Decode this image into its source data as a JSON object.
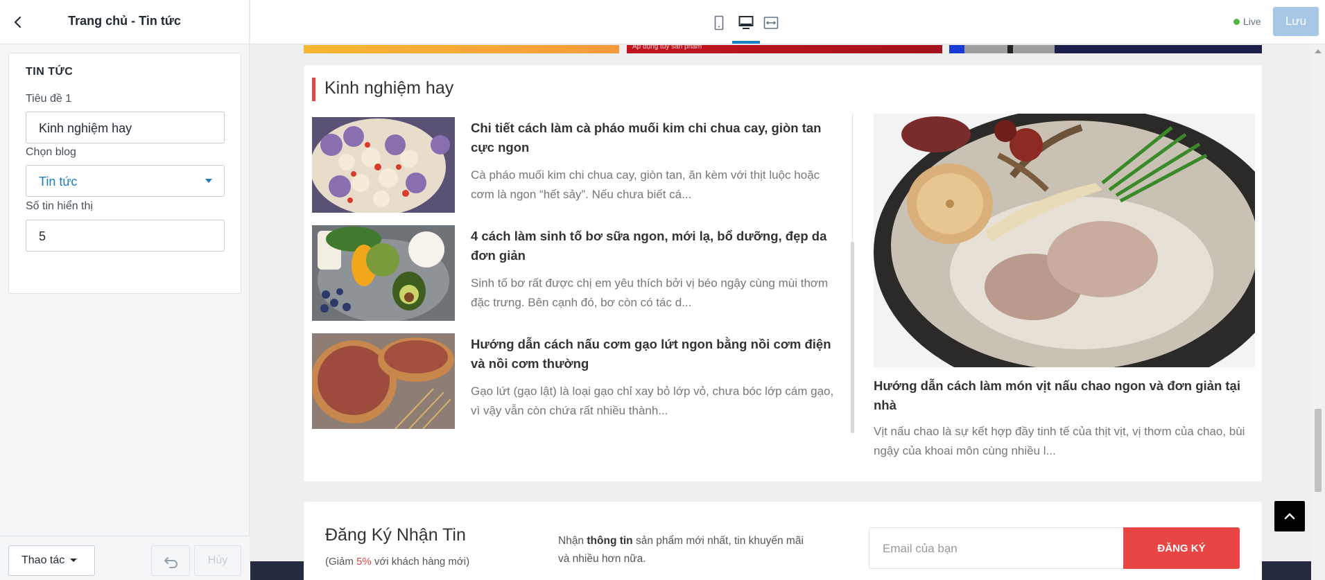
{
  "sidebar": {
    "title": "Trang chủ - Tin tức",
    "card_title": "TIN TỨC",
    "fields": {
      "title_label": "Tiêu đề 1",
      "title_value": "Kinh nghiệm hay",
      "blog_label": "Chọn blog",
      "blog_value": "Tin tức",
      "count_label": "Số tin hiển thị",
      "count_value": "5"
    },
    "footer": {
      "actions_label": "Thao tác",
      "cancel_label": "Hủy"
    }
  },
  "topbar": {
    "live_label": "Live",
    "save_label": "Lưu",
    "live_color": "#50b83c",
    "accent_color": "#1a7ec2",
    "devices": [
      "mobile-icon",
      "desktop-icon",
      "fullwidth-icon"
    ],
    "active_device": "desktop-icon"
  },
  "preview": {
    "banner_caption": "Áp dụng tùy sản phẩm",
    "section_title": "Kinh nghiệm hay",
    "articles": [
      {
        "title": "Chi tiết cách làm cà pháo muối kim chi chua cay, giòn tan cực ngon",
        "excerpt": "Cà pháo muối kim chi chua cay, giòn tan, ăn kèm với thịt luộc hoặc cơm là ngon “hết sảy”. Nếu chưa biết cá..."
      },
      {
        "title": "4 cách làm sinh tố bơ sữa ngon, mới lạ, bổ dưỡng, đẹp da đơn giản",
        "excerpt": "Sinh tố bơ rất được chị em yêu thích bởi vị béo ngậy cùng mùi thơm đặc trưng. Bên cạnh đó, bơ còn có tác d..."
      },
      {
        "title": "Hướng dẫn cách nấu cơm gạo lứt ngon bằng nồi cơm điện và nồi cơm thường",
        "excerpt": "Gạo lứt (gạo lật) là loại gạo chỉ xay bỏ lớp vỏ, chưa bóc lớp cám gạo, vì vậy vẫn còn chứa rất nhiều thành..."
      }
    ],
    "featured": {
      "title": "Hướng dẫn cách làm món vịt nấu chao ngon và đơn giản tại nhà",
      "excerpt": "Vịt nấu chao là sự kết hợp đầy tinh tế của thịt vịt, vị thơm của chao, bùi ngậy của khoai môn cùng nhiều l..."
    },
    "newsletter": {
      "title": "Đăng Ký Nhận Tin",
      "sub_prefix": "(Giảm ",
      "sub_highlight": "5%",
      "sub_suffix": " với khách hàng mới)",
      "text_prefix": "Nhận ",
      "text_bold": "thông tin",
      "text_suffix": " sản phẩm mới nhất, tin khuyến mãi và nhiều hơn nữa.",
      "email_placeholder": "Email của bạn",
      "button_label": "ĐĂNG KÝ",
      "accent_color": "#e84545"
    }
  }
}
